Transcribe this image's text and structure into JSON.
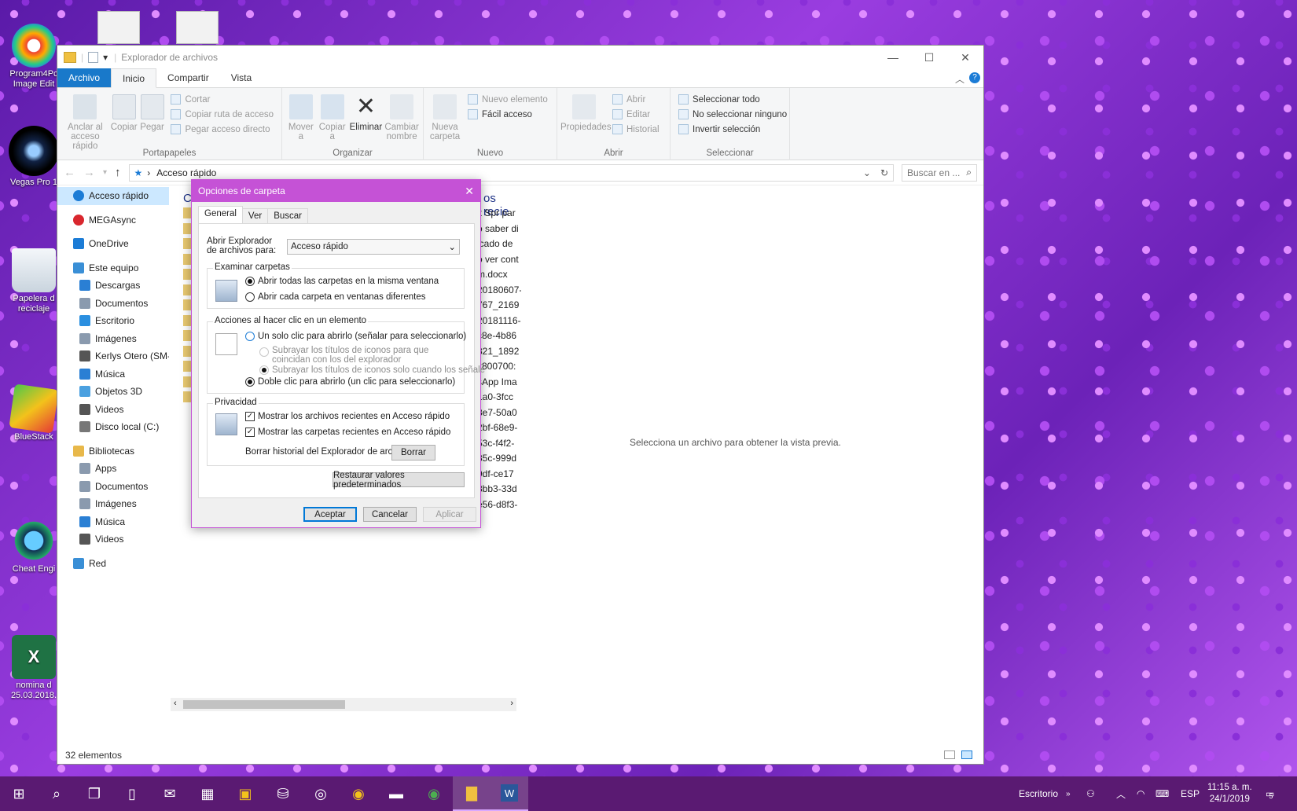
{
  "desktop": {
    "icons": [
      {
        "label": "Program4Pc Image Edit",
        "color": "#2a2a2a"
      },
      {
        "label": "Vegas Pro 1",
        "color": "#1b1b3a"
      },
      {
        "label": "Papelera d reciclaje",
        "color": "#dfe6ee"
      },
      {
        "label": "BlueStack",
        "color": "#3cb44a"
      },
      {
        "label": "Cheat Engi",
        "color": "#2b5f8f"
      },
      {
        "label": "nomina d 25.03.2018.",
        "color": "#1f7244"
      }
    ]
  },
  "explorer": {
    "title": "Explorador de archivos",
    "tabs": [
      "Archivo",
      "Inicio",
      "Compartir",
      "Vista"
    ],
    "ribbon": {
      "portapapeles": {
        "label": "Portapapeles",
        "pin": "Anclar al acceso rápido",
        "copy": "Copiar",
        "paste": "Pegar",
        "cut": "Cortar",
        "copy_path": "Copiar ruta de acceso",
        "paste_shortcut": "Pegar acceso directo"
      },
      "organizar": {
        "label": "Organizar",
        "move": "Mover a",
        "copy_to": "Copiar a",
        "delete": "Eliminar",
        "rename": "Cambiar nombre"
      },
      "nuevo": {
        "label": "Nuevo",
        "new_folder": "Nueva carpeta",
        "new_item": "Nuevo elemento",
        "easy_access": "Fácil acceso"
      },
      "abrir": {
        "label": "Abrir",
        "properties": "Propiedades",
        "open": "Abrir",
        "edit": "Editar",
        "history": "Historial"
      },
      "seleccionar": {
        "label": "Seleccionar",
        "all": "Seleccionar todo",
        "none": "No seleccionar ninguno",
        "invert": "Invertir selección"
      }
    },
    "address": {
      "path": "Acceso rápido",
      "search_placeholder": "Buscar en ..."
    },
    "nav": [
      {
        "label": "Acceso rápido",
        "level": 1,
        "selected": true,
        "icon": "star-icon",
        "color": "#1c7cd6"
      },
      {
        "label": "MEGAsync",
        "level": 1,
        "icon": "mega-icon",
        "color": "#d9272e"
      },
      {
        "label": "OneDrive",
        "level": 1,
        "icon": "cloud-icon",
        "color": "#1c7cd6"
      },
      {
        "label": "Este equipo",
        "level": 1,
        "icon": "computer-icon",
        "color": "#3a8fd6"
      },
      {
        "label": "Descargas",
        "level": 2,
        "icon": "download-icon",
        "color": "#2a7fd4"
      },
      {
        "label": "Documentos",
        "level": 2,
        "icon": "documents-icon",
        "color": "#8a9aae"
      },
      {
        "label": "Escritorio",
        "level": 2,
        "icon": "desktop-icon",
        "color": "#2a8fe0"
      },
      {
        "label": "Imágenes",
        "level": 2,
        "icon": "pictures-icon",
        "color": "#8a9aae"
      },
      {
        "label": "Kerlys Otero (SM-T",
        "level": 2,
        "icon": "phone-icon",
        "color": "#555"
      },
      {
        "label": "Música",
        "level": 2,
        "icon": "music-icon",
        "color": "#2a7fd4"
      },
      {
        "label": "Objetos 3D",
        "level": 2,
        "icon": "cube-icon",
        "color": "#4aa0e0"
      },
      {
        "label": "Videos",
        "level": 2,
        "icon": "video-icon",
        "color": "#555"
      },
      {
        "label": "Disco local (C:)",
        "level": 2,
        "icon": "disk-icon",
        "color": "#777"
      },
      {
        "label": "Bibliotecas",
        "level": 1,
        "icon": "library-icon",
        "color": "#e8b84a"
      },
      {
        "label": "Apps",
        "level": 2,
        "icon": "apps-icon",
        "color": "#8a9aae"
      },
      {
        "label": "Documentos",
        "level": 2,
        "icon": "documents-icon",
        "color": "#8a9aae"
      },
      {
        "label": "Imágenes",
        "level": 2,
        "icon": "pictures-icon",
        "color": "#8a9aae"
      },
      {
        "label": "Música",
        "level": 2,
        "icon": "music-icon",
        "color": "#2a7fd4"
      },
      {
        "label": "Videos",
        "level": 2,
        "icon": "video-icon",
        "color": "#555"
      },
      {
        "label": "Red",
        "level": 1,
        "icon": "network-icon",
        "color": "#3a8fd6"
      }
    ],
    "content": {
      "heading_left": "C",
      "heading_right": "os recie",
      "files": [
        "lt Spr par",
        "o saber di",
        "icado de",
        "o ver cont",
        "m.docx",
        "20180607-",
        "767_2169",
        "20181116-",
        "c8e-4b86",
        "321_1892",
        "x800700:",
        "sApp Ima",
        "1a0-3fcc",
        "8e7-50a0",
        "2bf-68e9-",
        "53c-f4f2-",
        "35c-999d",
        "9df-ce17",
        "8bb3-33d",
        "e56-d8f3-"
      ]
    },
    "preview_text": "Selecciona un archivo para obtener la vista previa.",
    "status": "32 elementos"
  },
  "dialog": {
    "title": "Opciones de carpeta",
    "tabs": [
      "General",
      "Ver",
      "Buscar"
    ],
    "open_label": "Abrir Explorador de archivos para:",
    "open_value": "Acceso rápido",
    "browse": {
      "label": "Examinar carpetas",
      "opt1": "Abrir todas las carpetas en la misma ventana",
      "opt2": "Abrir cada carpeta en ventanas diferentes"
    },
    "click": {
      "label": "Acciones al hacer clic en un elemento",
      "single": "Un solo clic para abrirlo (señalar para seleccionarlo)",
      "underline_all": "Subrayar los títulos de iconos para que coincidan con los del explorador",
      "underline_hover": "Subrayar los títulos de iconos solo cuando los señale",
      "double": "Doble clic para abrirlo (un clic para seleccionarlo)"
    },
    "privacy": {
      "label": "Privacidad",
      "recent_files": "Mostrar los archivos recientes en Acceso rápido",
      "recent_folders": "Mostrar las carpetas recientes en Acceso rápido",
      "clear_label": "Borrar historial del Explorador de archivos",
      "clear_button": "Borrar"
    },
    "restore": "Restaurar valores predeterminados",
    "ok": "Aceptar",
    "cancel": "Cancelar",
    "apply": "Aplicar"
  },
  "taskbar": {
    "location": "Escritorio",
    "lang": "ESP",
    "time": "11:15 a. m.",
    "date": "24/1/2019",
    "notif_count": "5",
    "accent": "#5a1a72"
  }
}
